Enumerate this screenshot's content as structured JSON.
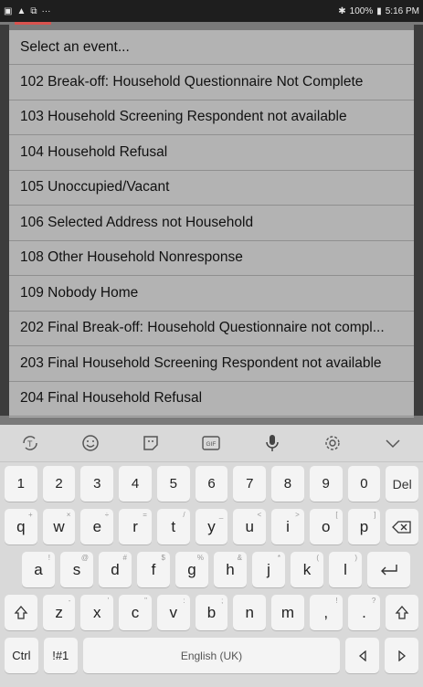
{
  "status_bar": {
    "left_icons": [
      "image-icon",
      "warning-icon",
      "cast-icon",
      "more-icon"
    ],
    "bluetooth": "✱",
    "battery": "100%",
    "time": "5:16 PM"
  },
  "event_list": {
    "header": "Select an event...",
    "items": [
      "102 Break-off: Household Questionnaire Not Complete",
      "103 Household Screening Respondent not available",
      "104 Household Refusal",
      "105 Unoccupied/Vacant",
      "106 Selected Address not Household",
      "108 Other Household Nonresponse",
      "109 Nobody Home",
      "202 Final Break-off: Household Questionnaire not compl...",
      "203 Final Household Screening Respondent not available",
      "204 Final Household Refusal"
    ]
  },
  "keyboard": {
    "toolbar": [
      "translate-icon",
      "emoji-icon",
      "sticker-icon",
      "gif-icon",
      "microphone-icon",
      "settings-icon",
      "collapse-icon"
    ],
    "number_row": [
      "1",
      "2",
      "3",
      "4",
      "5",
      "6",
      "7",
      "8",
      "9",
      "0"
    ],
    "delete_label": "Del",
    "row1": [
      "q",
      "w",
      "e",
      "r",
      "t",
      "y",
      "u",
      "i",
      "o",
      "p"
    ],
    "row1_hints": [
      "+",
      "×",
      "÷",
      "=",
      "/",
      "_",
      "<",
      ">",
      "[",
      "]"
    ],
    "row2": [
      "a",
      "s",
      "d",
      "f",
      "g",
      "h",
      "j",
      "k",
      "l"
    ],
    "row2_hints": [
      "!",
      "@",
      "#",
      "$",
      "%",
      "&",
      "*",
      "(",
      ")"
    ],
    "row3": [
      "z",
      "x",
      "c",
      "v",
      "b",
      "n",
      "m",
      ",",
      "."
    ],
    "row3_hints": [
      "-",
      "'",
      "\"",
      ":",
      ";",
      "",
      "",
      "!",
      "?"
    ],
    "ctrl_label": "Ctrl",
    "symbols_label": "!#1",
    "space_label": "English (UK)"
  }
}
